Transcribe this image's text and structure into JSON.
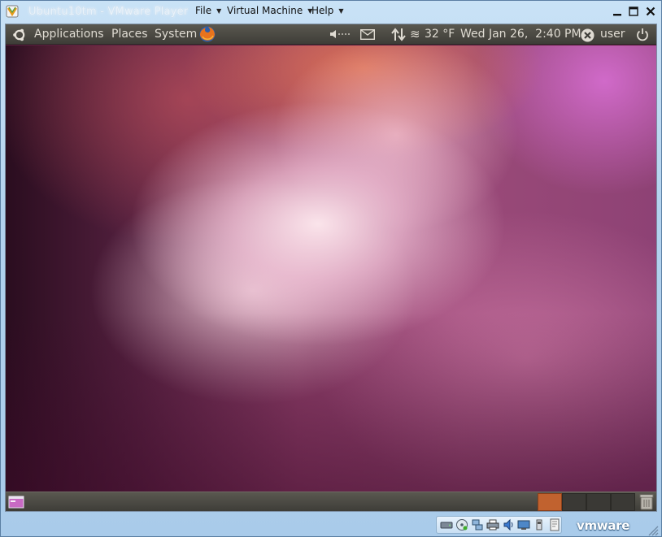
{
  "window": {
    "title": "Ubuntu10tm - VMware Player",
    "menus": {
      "file": "File",
      "virtual_machine": "Virtual Machine",
      "help": "Help"
    },
    "controls": {
      "minimize": "minimize-icon",
      "maximize": "maximize-icon",
      "close": "close-icon"
    }
  },
  "guest": {
    "top_panel": {
      "menus": {
        "applications": "Applications",
        "places": "Places",
        "system": "System"
      },
      "launchers": [
        "firefox-icon"
      ],
      "indicators": {
        "volume": "volume-muted-icon",
        "mail": "mail-icon",
        "network": "network-icon",
        "weather": "weather-icon"
      },
      "temperature": "32 °F",
      "clock": "Wed Jan 26,  2:40 PM",
      "user": "user"
    },
    "bottom_panel": {
      "workspaces": [
        {
          "active": true
        },
        {
          "active": false
        },
        {
          "active": false
        },
        {
          "active": false
        }
      ]
    },
    "wallpaper_colors": {
      "dark": "#2a0d1f",
      "mid": "#8e3f6a",
      "light": "#f6d6e4",
      "orange": "#e07a52"
    }
  },
  "statusbar": {
    "devices": [
      "hard-disk-icon",
      "cd-dvd-icon",
      "network-adapter-icon",
      "printer-icon",
      "sound-card-icon",
      "display-icon",
      "usb-device-icon",
      "message-icon"
    ],
    "brand": "vmware"
  },
  "colors": {
    "frame": "#b2d2ee",
    "panel": "#4a4944",
    "workspace_active": "#c1622f"
  }
}
